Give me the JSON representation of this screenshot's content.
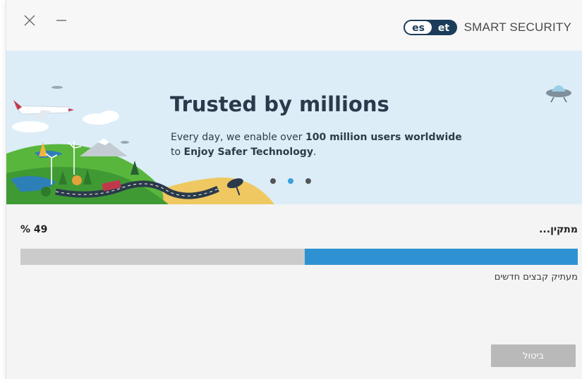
{
  "titlebar": {
    "close_icon": "close-icon",
    "minimize_icon": "minimize-icon",
    "brand_logo": "eset",
    "product_name": "SMART SECURITY"
  },
  "banner": {
    "title": "Trusted by millions",
    "line1_prefix": "Every day, we enable over ",
    "line1_bold": "100 million users worldwide",
    "line2_prefix": "to ",
    "line2_bold": "Enjoy Safer Technology",
    "line2_suffix": ".",
    "carousel_dots": 3,
    "active_dot": 1
  },
  "progress": {
    "status_label": "מתקין...",
    "percent_text": "% 49",
    "percent": 49,
    "substatus": "מעתיק קבצים חדשים"
  },
  "actions": {
    "cancel_label": "ביטול"
  },
  "colors": {
    "accent": "#2e92d2",
    "track": "#cbcbcb",
    "banner_sky": "#dbeef9",
    "button_disabled": "#b9b9b9",
    "brand_navy": "#1c3d5a"
  }
}
